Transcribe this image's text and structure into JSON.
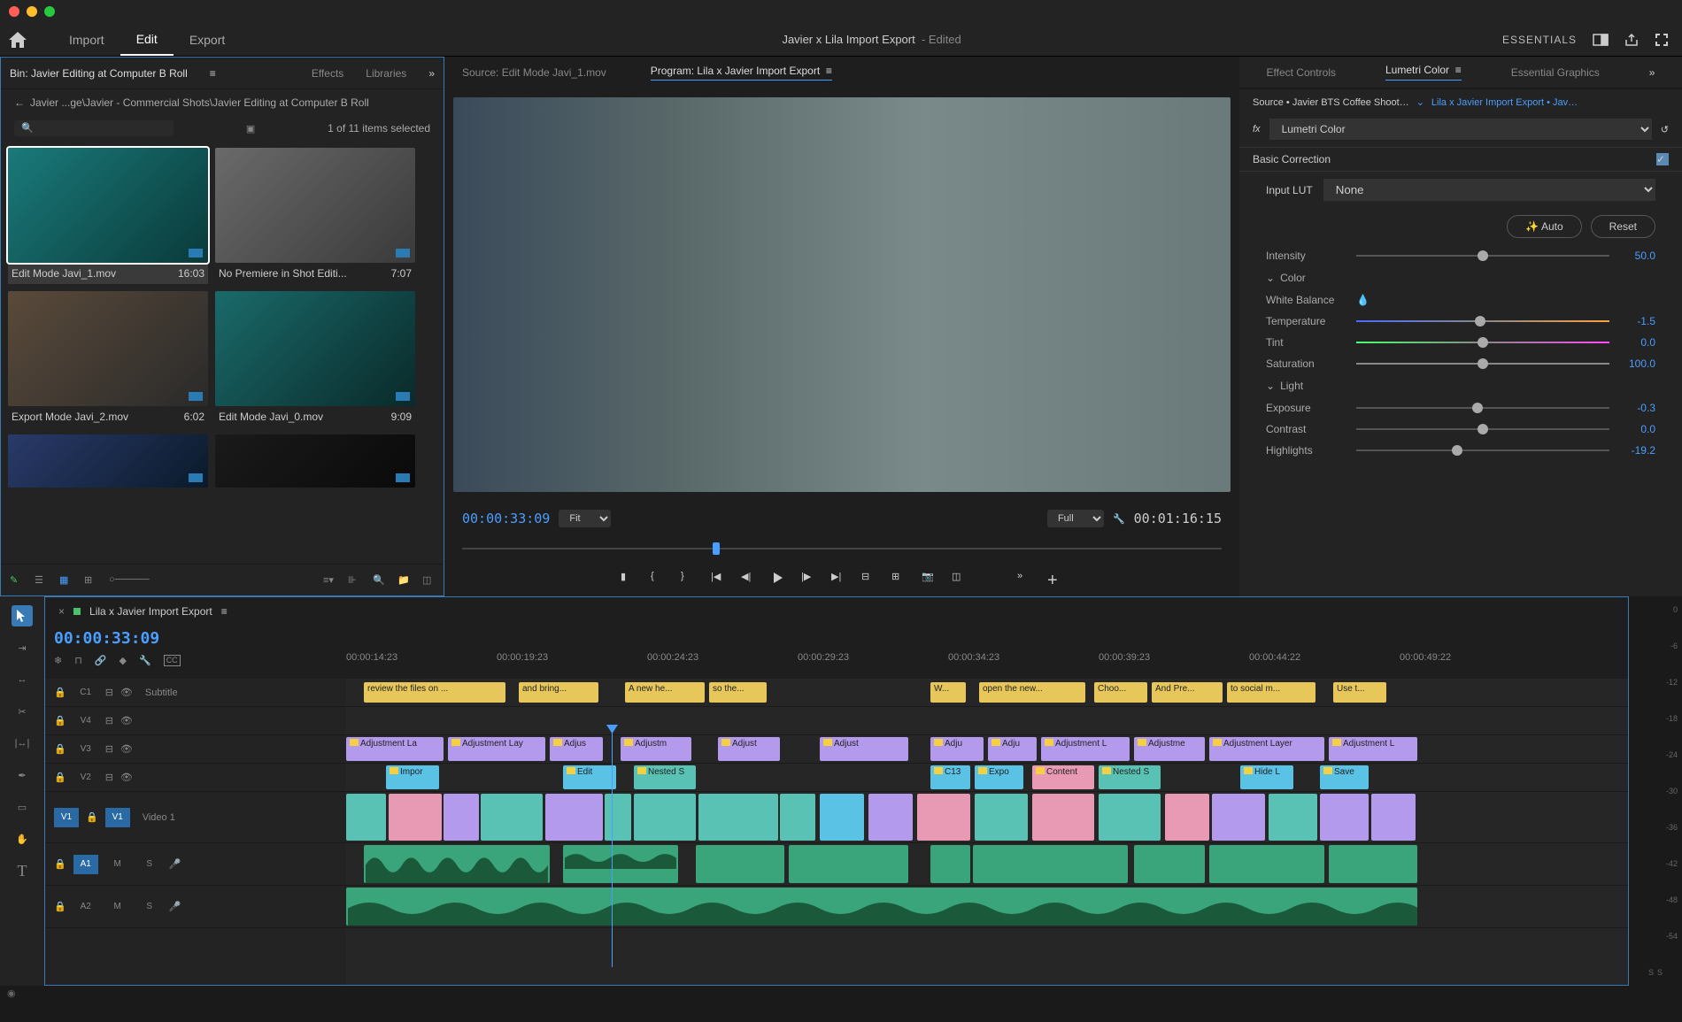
{
  "title": {
    "project": "Javier x Lila Import Export",
    "status": "- Edited"
  },
  "menubar": {
    "import": "Import",
    "edit": "Edit",
    "export": "Export",
    "workspace": "ESSENTIALS"
  },
  "project": {
    "bin_tab": "Bin: Javier Editing at Computer B Roll",
    "effects_tab": "Effects",
    "libraries_tab": "Libraries",
    "breadcrumb": "Javier ...ge\\Javier - Commercial Shots\\Javier Editing at Computer B Roll",
    "items_selected": "1 of 11 items selected",
    "clips": [
      {
        "name": "Edit Mode Javi_1.mov",
        "dur": "16:03"
      },
      {
        "name": "No Premiere in Shot Editi...",
        "dur": "7:07"
      },
      {
        "name": "Export Mode Javi_2.mov",
        "dur": "6:02"
      },
      {
        "name": "Edit Mode Javi_0.mov",
        "dur": "9:09"
      }
    ]
  },
  "source": {
    "tab": "Source: Edit Mode Javi_1.mov"
  },
  "program": {
    "tab": "Program: Lila x Javier Import Export",
    "timecode": "00:00:33:09",
    "fit": "Fit",
    "full": "Full",
    "duration": "00:01:16:15"
  },
  "lumetri": {
    "tabs": {
      "ec": "Effect Controls",
      "lc": "Lumetri Color",
      "eg": "Essential Graphics"
    },
    "source_label": "Source • Javier BTS Coffee Shoot…",
    "source_link": "Lila x Javier Import Export • Jav…",
    "fx_name": "Lumetri Color",
    "basic": "Basic Correction",
    "input_lut": "Input LUT",
    "lut_none": "None",
    "auto": "Auto",
    "reset": "Reset",
    "intensity": "Intensity",
    "intensity_val": "50.0",
    "color_group": "Color",
    "wb": "White Balance",
    "temp": "Temperature",
    "temp_val": "-1.5",
    "tint": "Tint",
    "tint_val": "0.0",
    "sat": "Saturation",
    "sat_val": "100.0",
    "light_group": "Light",
    "exposure": "Exposure",
    "exposure_val": "-0.3",
    "contrast": "Contrast",
    "contrast_val": "0.0",
    "highlights": "Highlights",
    "highlights_val": "-19.2"
  },
  "timeline": {
    "seq_name": "Lila x Javier Import Export",
    "timecode": "00:00:33:09",
    "ruler": [
      "00:00:14:23",
      "00:00:19:23",
      "00:00:24:23",
      "00:00:29:23",
      "00:00:34:23",
      "00:00:39:23",
      "00:00:44:22",
      "00:00:49:22"
    ],
    "tracks": {
      "c1": "C1",
      "subtitle": "Subtitle",
      "v4": "V4",
      "v3": "V3",
      "v2": "V2",
      "v1_src": "V1",
      "v1": "V1",
      "video1": "Video 1",
      "a1_src": "A1",
      "a1": "A1",
      "a2": "A2",
      "m": "M",
      "s": "S"
    },
    "subtitles": [
      "review the files on ...",
      "and bring...",
      "A new he...",
      "so the...",
      "W...",
      "open the new...",
      "Choo...",
      "And Pre...",
      "to social m...",
      "Use t..."
    ],
    "adj": [
      "Adjustment La",
      "Adjustment Lay",
      "Adjus",
      "Adjustm",
      "Adjust",
      "Adju",
      "Adju",
      "Adjustment L",
      "Adjustme",
      "Adjustment Layer",
      "Adjustment L"
    ],
    "v1_clips": [
      "Impor",
      "Edit",
      "Nested S",
      "C13",
      "Expo",
      "Content",
      "Nested S",
      "Hide L",
      "Save"
    ]
  },
  "meter": {
    "levels": [
      "0",
      "-6",
      "-12",
      "-18",
      "-24",
      "-30",
      "-36",
      "-42",
      "-48",
      "-54"
    ],
    "solo": "S"
  }
}
